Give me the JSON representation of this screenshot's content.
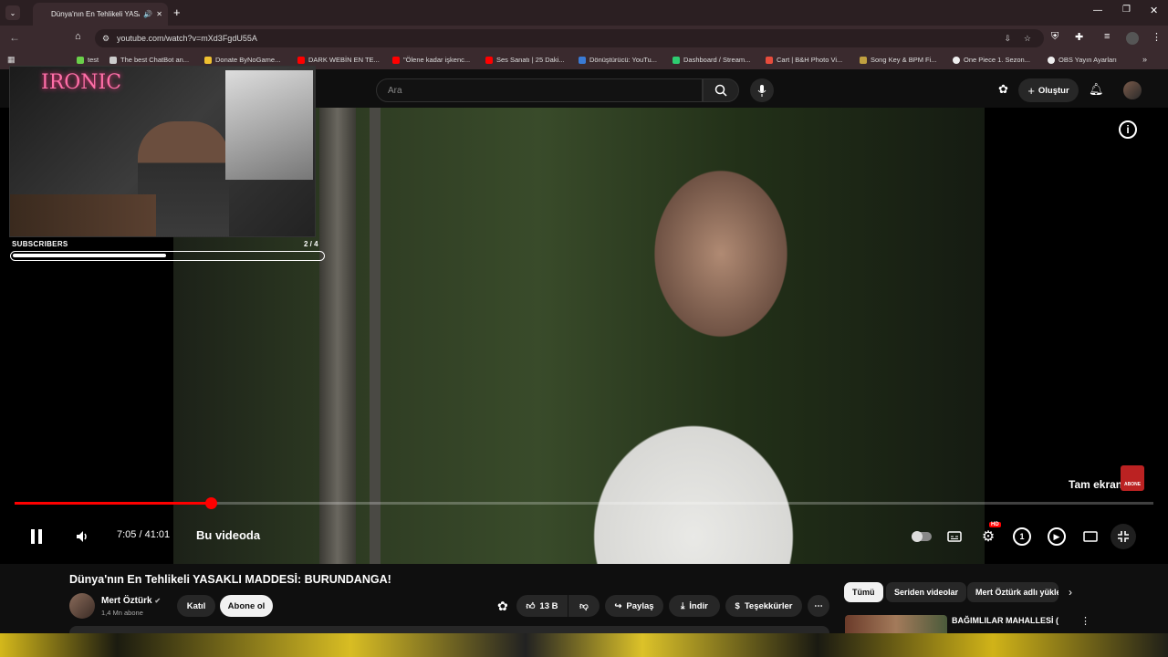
{
  "browser": {
    "tab_title": "Dünya'nın En Tehlikeli YASAKLI",
    "url": "youtube.com/watch?v=mXd3FgdU55A",
    "bookmarks": [
      {
        "label": "test",
        "color": "#ffffff"
      },
      {
        "label": "The best ChatBot an...",
        "color": "#cccccc"
      },
      {
        "label": "Donate ByNoGame...",
        "color": "#f0c030"
      },
      {
        "label": "DARK WEBİN EN TE...",
        "color": "#ff0000"
      },
      {
        "label": "\"Ölene kadar işkenc...",
        "color": "#ff0000"
      },
      {
        "label": "Ses Sanatı | 25 Daki...",
        "color": "#ff0000"
      },
      {
        "label": "Dönüştürücü: YouTu...",
        "color": "#3a7bd5"
      },
      {
        "label": "Dashboard / Stream...",
        "color": "#2ecc71"
      },
      {
        "label": "Cart | B&H Photo Vi...",
        "color": "#e74c3c"
      },
      {
        "label": "Song Key & BPM Fi...",
        "color": "#c0a040"
      },
      {
        "label": "One Piece 1. Sezon...",
        "color": "#eeeeee"
      },
      {
        "label": "OBS Yayın Ayarları",
        "color": "#eeeeee"
      }
    ]
  },
  "youtube": {
    "search_placeholder": "Ara",
    "create_label": "Oluştur"
  },
  "overlay": {
    "neon_text": "IRONIC",
    "subscribers_label": "SUBSCRIBERS",
    "subscribers_count": "2 / 4",
    "subscribers_progress": 0.5
  },
  "player": {
    "time": "7:05 / 41:01",
    "chapter": "Bu videoda",
    "fullscreen_tooltip": "Tam ekran (f)",
    "progress_fraction": 0.172,
    "hd_badge": "HD",
    "accent_color": "#ff0000"
  },
  "video_info": {
    "title": "Dünya'nın En Tehlikeli YASAKLI MADDESİ: BURUNDANGA!",
    "channel_name": "Mert Öztürk",
    "channel_subs": "1,4 Mn abone",
    "join_label": "Katıl",
    "subscribe_label": "Abone ol",
    "likes": "13 B",
    "share_label": "Paylaş",
    "download_label": "İndir",
    "thanks_label": "Teşekkürler"
  },
  "recommendations": {
    "chips": [
      "Tümü",
      "Seriden videolar",
      "Mert Öztürk adlı yükle"
    ],
    "first_title": "BAĞIMLILAR MAHALLESİ ("
  }
}
